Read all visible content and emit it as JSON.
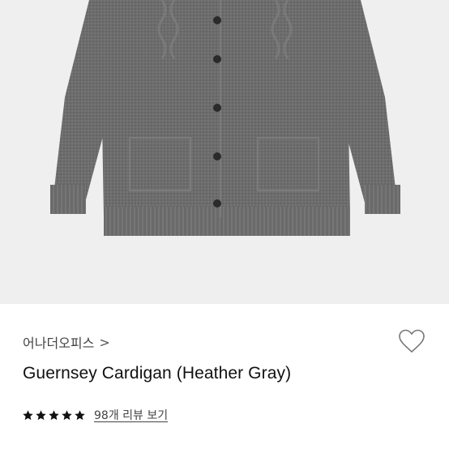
{
  "product": {
    "image_alt": "Guernsey Cardigan (Heather Gray)",
    "brand": "어나더오피스",
    "brand_chevron": ">",
    "name": "Guernsey Cardigan (Heather Gray)",
    "rating_stars": 5,
    "rating_max": 5,
    "review_link": "98개 리뷰 보기",
    "like_icon": "heart-outline-icon"
  },
  "colors": {
    "star": "#111111",
    "heart": "#777777",
    "hero_bg": "#efefef",
    "knit": "#6f6f6f"
  }
}
